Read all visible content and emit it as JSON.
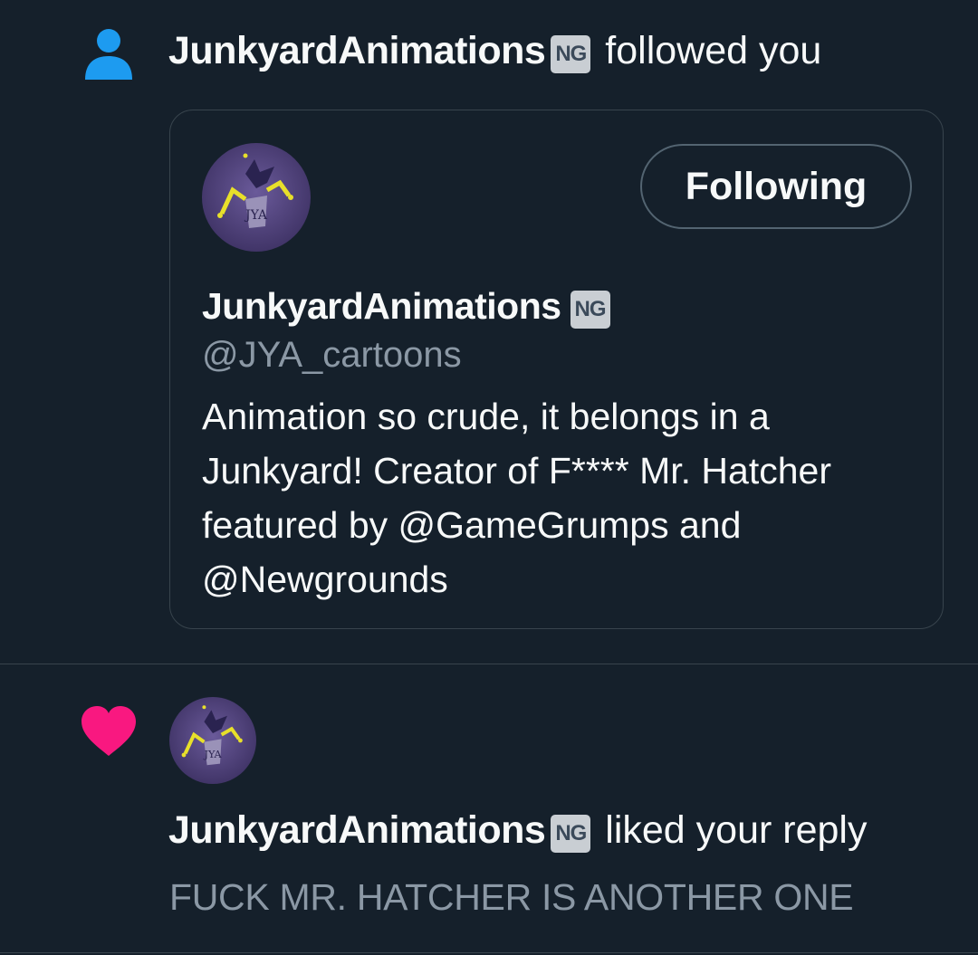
{
  "follow_notification": {
    "user_name": "JunkyardAnimations",
    "badge": "NG",
    "action_text": "followed you",
    "card": {
      "name": "JunkyardAnimations",
      "badge": "NG",
      "handle": "@JYA_cartoons",
      "bio_lines": [
        "Animation so crude, it belongs in a",
        "Junkyard! Creator of F**** Mr. Hatcher",
        "featured by @GameGrumps and",
        "@Newgrounds"
      ],
      "follow_button_label": "Following",
      "avatar_text": "JYA"
    }
  },
  "like_notification": {
    "user_name": "JunkyardAnimations",
    "badge": "NG",
    "action_text": "liked your reply",
    "reply_text": "FUCK MR. HATCHER IS ANOTHER ONE",
    "avatar_text": "JYA"
  },
  "icons": {
    "follow_icon": "person-icon",
    "like_icon": "heart-icon"
  },
  "colors": {
    "background": "#15202b",
    "person_icon": "#1d9bf0",
    "heart_icon": "#f91880",
    "secondary_text": "#8b98a5",
    "border": "#38444d"
  }
}
